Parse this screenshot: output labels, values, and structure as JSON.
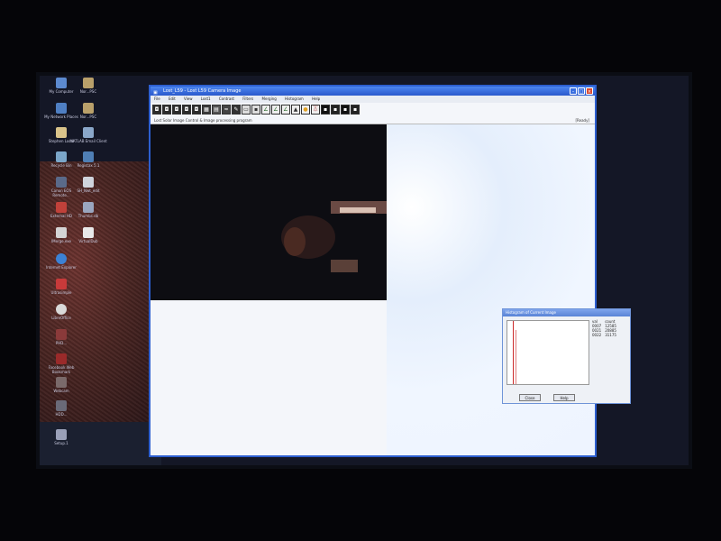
{
  "desktop": {
    "icons": [
      {
        "label": "My Computer"
      },
      {
        "label": "Nor...PSC"
      },
      {
        "label": "My Network Places"
      },
      {
        "label": "Nor...PSC"
      },
      {
        "label": "Stephen Local"
      },
      {
        "label": "MATLAB Email Client"
      },
      {
        "label": "Recycle Bin"
      },
      {
        "label": "Registax 5.1"
      },
      {
        "label": "Canon EOS Remote..."
      },
      {
        "label": "SH_Nwt_edit"
      },
      {
        "label": "External HD"
      },
      {
        "label": "Thumbs.db"
      },
      {
        "label": "IMerge.exe"
      },
      {
        "label": "VirtualDub"
      },
      {
        "label": "Internet Explorer"
      },
      {
        "label": "Ultrasimple"
      },
      {
        "label": "LibreOffice"
      },
      {
        "label": "PHD..."
      },
      {
        "label": "Facebook Web Bookmark"
      },
      {
        "label": "Webcam"
      },
      {
        "label": "HDD..."
      },
      {
        "label": "Setup.1"
      }
    ]
  },
  "app": {
    "title": "Lost_L59 - Lost L59 Camera Image",
    "menu": [
      "File",
      "Edit",
      "View",
      "Lost1",
      "Contrast",
      "Filters",
      "Merging",
      "Histogram",
      "Help"
    ],
    "status": "Lost Solar Image Control & Image processing program",
    "status_right": "[Ready]",
    "toolbar_icons": [
      "camera-icon",
      "camera-icon",
      "camera-icon",
      "camera-icon",
      "camera-icon",
      "grid-icon",
      "film-icon",
      "wave-icon",
      "edit-icon",
      "image-icon",
      "save-icon",
      "curve-icon",
      "curve-icon",
      "curve-icon",
      "triangle-icon",
      "sun-icon",
      "flask-icon",
      "square-icon",
      "square-icon",
      "square-icon",
      "square-icon"
    ]
  },
  "histogram": {
    "title": "Histogram of Current Image",
    "columns": [
      "val",
      "count"
    ],
    "rows": [
      [
        "0007",
        "12585"
      ],
      [
        "0021",
        "20885"
      ],
      [
        "0022",
        "31175"
      ]
    ],
    "close_label": "Close",
    "help_label": "Help"
  },
  "colors": {
    "title_blue": "#2a59cc",
    "close_red": "#d9472f",
    "hist_line": "#cc2b2b"
  }
}
